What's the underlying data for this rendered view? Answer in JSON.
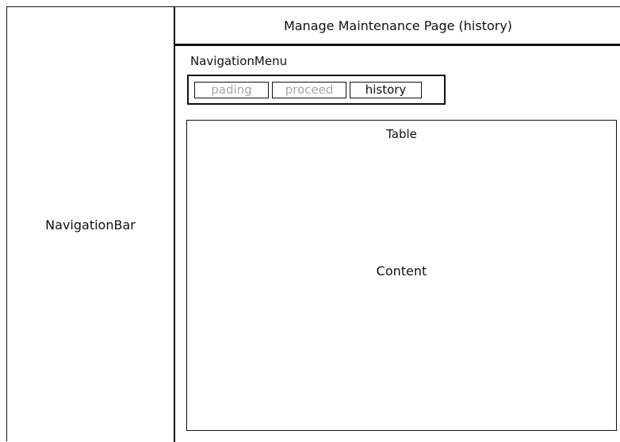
{
  "navigation_bar": {
    "label": "NavigationBar"
  },
  "header": {
    "title": "Manage Maintenance Page (history)"
  },
  "navigation_menu": {
    "title": "NavigationMenu",
    "tabs": [
      {
        "label": "pading",
        "active": false
      },
      {
        "label": "proceed",
        "active": false
      },
      {
        "label": "history",
        "active": true
      }
    ]
  },
  "table": {
    "title": "Table",
    "content_label": "Content"
  },
  "colors": {
    "border": "#111111",
    "inactive_text": "#a6a6a6",
    "background": "#ffffff"
  }
}
